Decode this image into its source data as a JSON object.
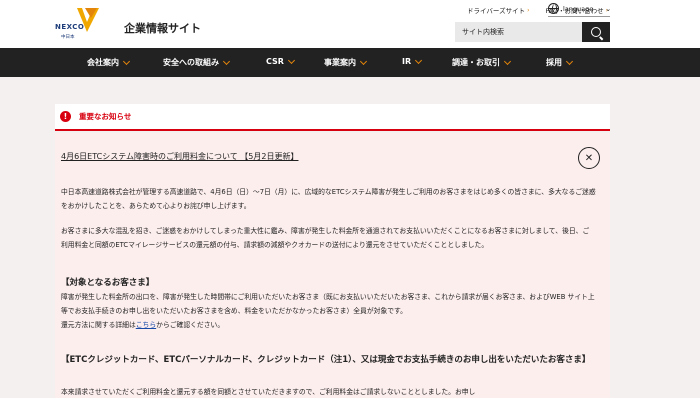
{
  "header": {
    "logo": {
      "brand": "NEXCO",
      "sub": "中日本"
    },
    "site_title": "企業情報サイト",
    "top_links": [
      {
        "label": "ドライバーズサイト"
      },
      {
        "label": "FAQ・お問い合わせ"
      }
    ],
    "language_label": "language",
    "search": {
      "placeholder": "サイト内検索"
    }
  },
  "nav": {
    "items": [
      {
        "label": "会社案内"
      },
      {
        "label": "安全への取組み"
      },
      {
        "label": "CSR"
      },
      {
        "label": "事業案内"
      },
      {
        "label": "IR"
      },
      {
        "label": "調達・お取引"
      },
      {
        "label": "採用"
      }
    ]
  },
  "notice": {
    "section_title": "重要なお知らせ",
    "heading": "4月6日ETCシステム障害時のご利用料金について 【5月2日更新】",
    "para1": "中日本高速道路株式会社が管理する高速道路で、4月6日（日）～7日（月）に、広域的なETCシステム障害が発生しご利用のお客さまをはじめ多くの皆さまに、多大なるご迷惑をおかけしたことを、あらためて心よりお詫び申し上げます。",
    "para2": "お客さまに多大な混乱を招き、ご迷惑をおかけしてしまった重大性に鑑み、障害が発生した料金所を通過されてお支払いいただくことになるお客さまに対しまして、後日、ご利用料金と同額のETCマイレージサービスの還元額の付与、請求額の減額やクオカードの送付により還元をさせていただくこととしました。",
    "section1_title": "【対象となるお客さま】",
    "para3": "障害が発生した料金所の出口を、障害が発生した時間帯にご利用いただいたお客さま（既にお支払いいただいたお客さま、これから請求が届くお客さま、およびWEB サイト上等でお支払手続きのお申し出をいただいたお客さまを含め、料金をいただかなかったお客さま）全員が対象です。",
    "para3_pre": "還元方法に関する詳細は",
    "para3_link": "こちら",
    "para3_post": "からご確認ください。",
    "section2_title": "【ETCクレジットカード、ETCパーソナルカード、クレジットカード（注1）、又は現金でお支払手続きのお申し出をいただいたお客さま】",
    "para4": "本来請求させていただくご利用料金と還元する額を同額とさせていただきますので、ご利用料金はご請求しないこととしました。お申し"
  },
  "colors": {
    "accent": "#e3850a",
    "alert": "#d8000f",
    "nav_bg": "#222222",
    "panel_bg": "#fdeeee",
    "link": "#1a4aa8"
  }
}
